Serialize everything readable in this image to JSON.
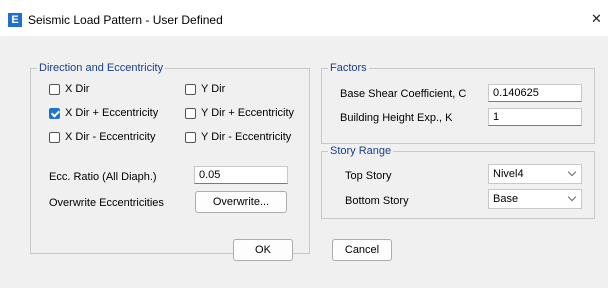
{
  "window": {
    "title": "Seismic Load Pattern - User Defined",
    "app_icon_letter": "E",
    "close_glyph": "✕"
  },
  "direction_group": {
    "title": "Direction and Eccentricity",
    "checkboxes": [
      {
        "label": "X Dir",
        "checked": false
      },
      {
        "label": "X Dir + Eccentricity",
        "checked": true
      },
      {
        "label": "X Dir - Eccentricity",
        "checked": false
      },
      {
        "label": "Y Dir",
        "checked": false
      },
      {
        "label": "Y Dir + Eccentricity",
        "checked": false
      },
      {
        "label": "Y Dir - Eccentricity",
        "checked": false
      }
    ],
    "ecc_ratio_label": "Ecc. Ratio (All Diaph.)",
    "ecc_ratio_value": "0.05",
    "overwrite_label": "Overwrite Eccentricities",
    "overwrite_button": "Overwrite..."
  },
  "factors_group": {
    "title": "Factors",
    "base_shear_label": "Base Shear Coefficient, C",
    "base_shear_value": "0.140625",
    "height_exp_label": "Building Height Exp., K",
    "height_exp_value": "1"
  },
  "story_range_group": {
    "title": "Story Range",
    "top_story_label": "Top Story",
    "top_story_value": "Nivel4",
    "bottom_story_label": "Bottom Story",
    "bottom_story_value": "Base"
  },
  "buttons": {
    "ok": "OK",
    "cancel": "Cancel"
  },
  "colors": {
    "accent": "#1e74cf",
    "group_title": "#1a3e8c",
    "app_icon": "#1e6fd0"
  }
}
